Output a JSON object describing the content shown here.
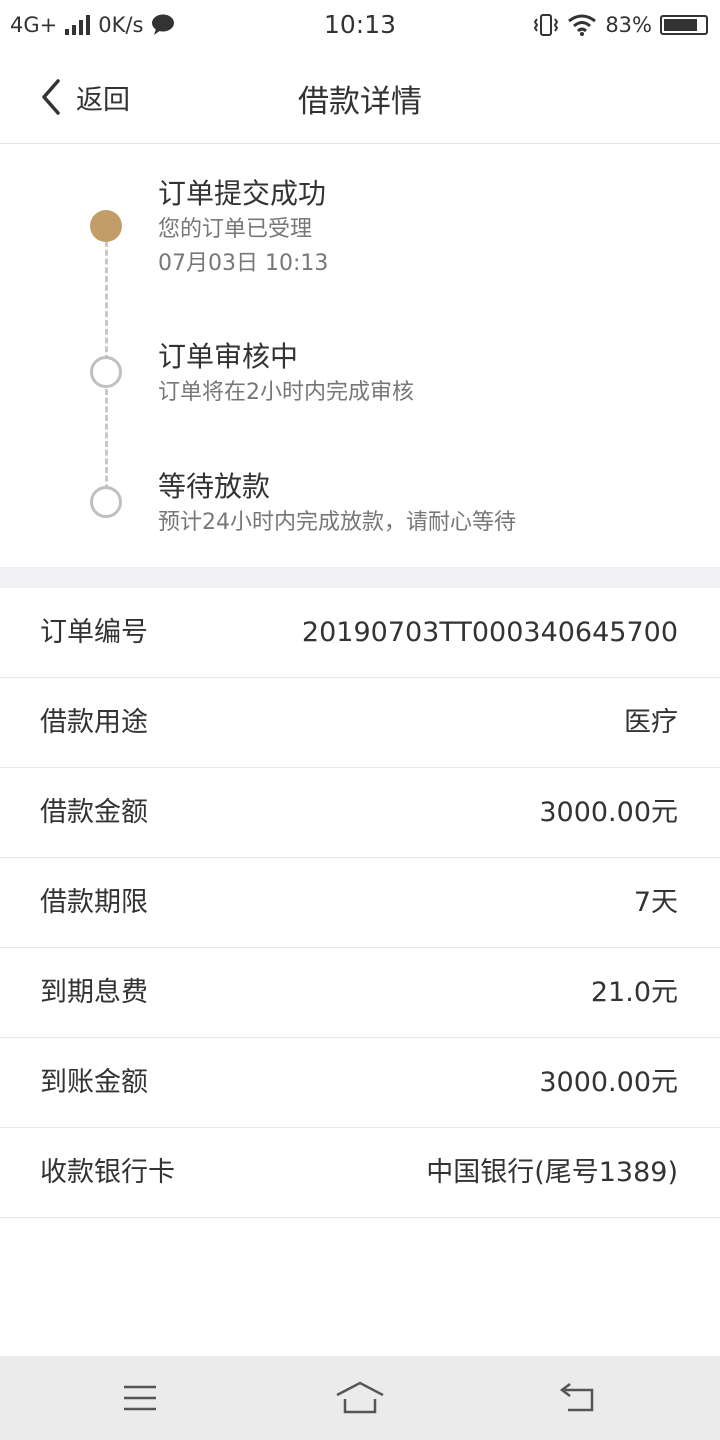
{
  "status_bar": {
    "network": "4G+",
    "speed": "0K/s",
    "time": "10:13",
    "battery": "83%",
    "battery_level": 0.83
  },
  "nav": {
    "back_label": "返回",
    "title": "借款详情"
  },
  "timeline": [
    {
      "title": "订单提交成功",
      "subtitle": "您的订单已受理",
      "time": "07月03日 10:13",
      "done": true
    },
    {
      "title": "订单审核中",
      "subtitle": "订单将在2小时内完成审核",
      "done": false
    },
    {
      "title": "等待放款",
      "subtitle": "预计24小时内完成放款，请耐心等待",
      "done": false
    }
  ],
  "details": [
    {
      "label": "订单编号",
      "value": "20190703TT000340645700"
    },
    {
      "label": "借款用途",
      "value": "医疗"
    },
    {
      "label": "借款金额",
      "value": "3000.00元"
    },
    {
      "label": "借款期限",
      "value": "7天"
    },
    {
      "label": "到期息费",
      "value": "21.0元"
    },
    {
      "label": "到账金额",
      "value": "3000.00元"
    },
    {
      "label": "收款银行卡",
      "value": "中国银行(尾号1389)"
    }
  ],
  "colors": {
    "accent": "#c29d67",
    "divider": "#f1f1f4",
    "system_nav_bg": "#ebebeb"
  },
  "icons": [
    "back-chevron-icon",
    "signal-icon",
    "chat-icon",
    "vibrate-icon",
    "wifi-icon",
    "battery-icon",
    "menu-icon",
    "home-icon",
    "back-arrow-icon"
  ]
}
